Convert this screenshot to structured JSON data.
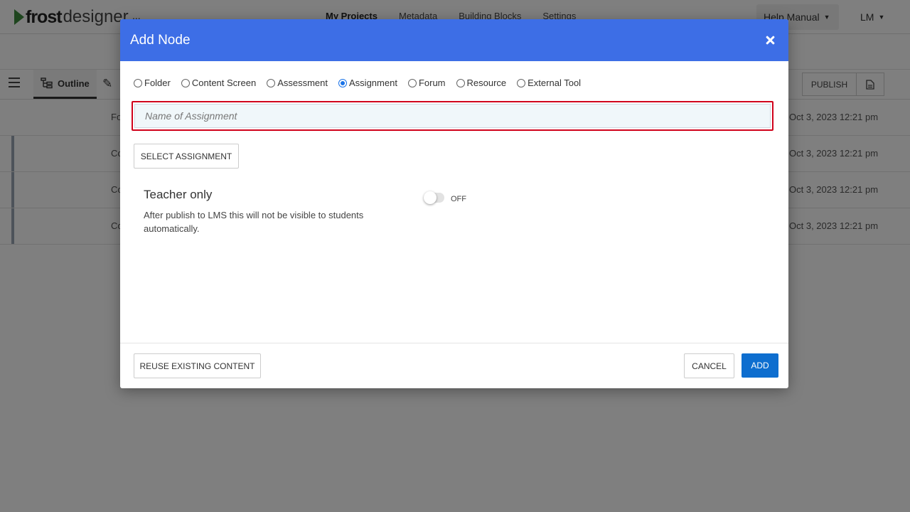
{
  "app": {
    "logo_bold": "frost",
    "logo_light": "designer",
    "ellipsis": "...",
    "nav": [
      {
        "label": "My Projects"
      },
      {
        "label": "Metadata"
      },
      {
        "label": "Building Blocks"
      },
      {
        "label": "Settings"
      }
    ],
    "help_label": "Help Manual",
    "user_initials": "LM",
    "toolbar": {
      "outline_label": "Outline",
      "publish_label": "PUBLISH"
    },
    "rows": [
      {
        "label": "Fo",
        "date": "Oct 3, 2023 12:21 pm"
      },
      {
        "label": "Co",
        "date": "Oct 3, 2023 12:21 pm"
      },
      {
        "label": "Co",
        "date": "Oct 3, 2023 12:21 pm"
      },
      {
        "label": "Co",
        "date": "Oct 3, 2023 12:21 pm"
      }
    ]
  },
  "modal": {
    "title": "Add Node",
    "node_types": [
      {
        "label": "Folder",
        "checked": false
      },
      {
        "label": "Content Screen",
        "checked": false
      },
      {
        "label": "Assessment",
        "checked": false
      },
      {
        "label": "Assignment",
        "checked": true
      },
      {
        "label": "Forum",
        "checked": false
      },
      {
        "label": "Resource",
        "checked": false
      },
      {
        "label": "External Tool",
        "checked": false
      }
    ],
    "name_field": {
      "placeholder": "Name of Assignment",
      "value": ""
    },
    "select_button": "SELECT ASSIGNMENT",
    "teacher_only": {
      "title": "Teacher only",
      "description": "After publish to LMS this will not be visible to students automatically.",
      "state": "OFF"
    },
    "footer": {
      "reuse_label": "REUSE EXISTING CONTENT",
      "cancel_label": "CANCEL",
      "add_label": "ADD"
    }
  },
  "colors": {
    "header_blue": "#3d6ee6",
    "add_button": "#0e6ecf",
    "highlight_red": "#d0021b",
    "logo_green": "#3d8b3d"
  }
}
